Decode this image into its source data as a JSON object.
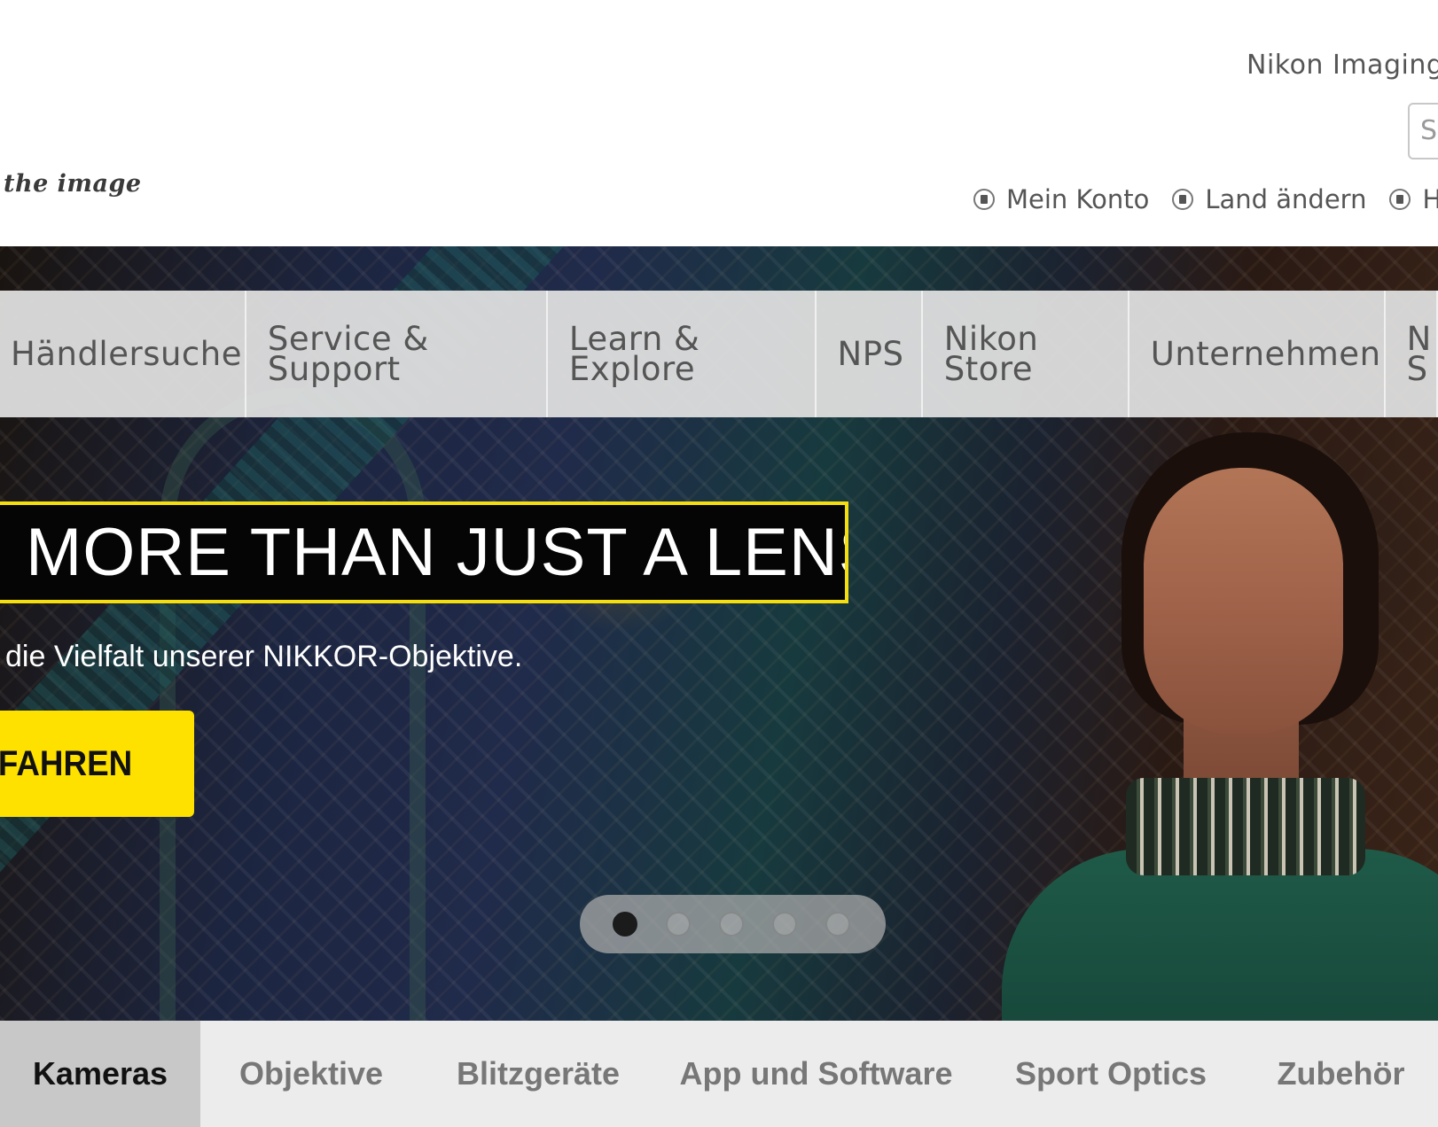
{
  "header": {
    "tagline": "the image",
    "site_name": "Nikon Imaging",
    "search_placeholder": "S",
    "util_links": [
      {
        "label": "Mein Konto"
      },
      {
        "label": "Land ändern"
      },
      {
        "label": "Hä"
      }
    ]
  },
  "main_nav": {
    "items": [
      {
        "label": "Händlersuche"
      },
      {
        "label": "Service &\nSupport"
      },
      {
        "label": "Learn &\nExplore"
      },
      {
        "label": "NPS"
      },
      {
        "label": "Nikon\nStore"
      },
      {
        "label": "Unternehmen"
      },
      {
        "label": "N\nS"
      }
    ]
  },
  "hero": {
    "headline": "MORE THAN JUST A LENS",
    "subline": "die Vielfalt unserer NIKKOR-Objektive.",
    "cta_label": "AFAHREN",
    "carousel": {
      "count": 5,
      "active_index": 0
    }
  },
  "categories": {
    "items": [
      {
        "label": "Kameras",
        "active": true
      },
      {
        "label": "Objektive"
      },
      {
        "label": "Blitzgeräte"
      },
      {
        "label": "App und Software"
      },
      {
        "label": "Sport Optics"
      },
      {
        "label": "Zubehör"
      }
    ]
  },
  "colors": {
    "accent_yellow": "#ffe100",
    "headline_border": "#f5de0f",
    "nav_bg": "#dedede",
    "active_tab_bg": "#c8c8c8"
  }
}
